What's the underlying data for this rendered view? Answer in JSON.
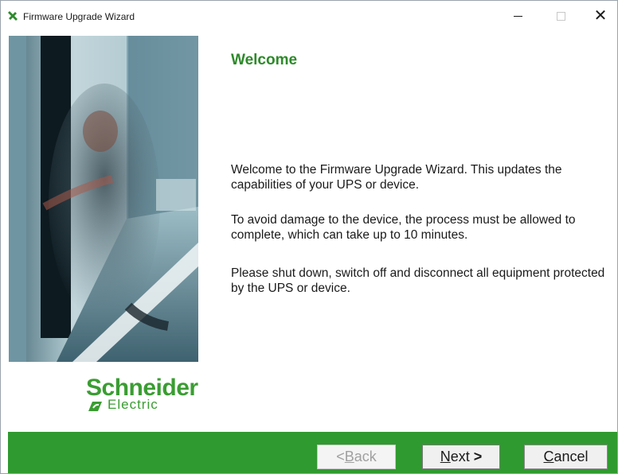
{
  "window": {
    "title": "Firmware Upgrade Wizard",
    "controls": {
      "minimize": "minimize",
      "maximize": "maximize",
      "close": "close"
    }
  },
  "branding": {
    "logo_main": "Schneider",
    "logo_sub": "Electric",
    "brand_color": "#3a9d32",
    "footer_color": "#2f9a2f"
  },
  "content": {
    "heading": "Welcome",
    "paragraphs": [
      "Welcome to the Firmware Upgrade Wizard. This updates the capabilities of your UPS or device.",
      "To avoid damage to the device, the process must be allowed to complete, which can take up to 10 minutes.",
      "Please shut down, switch off and disconnect all equipment protected by the UPS or device."
    ]
  },
  "buttons": {
    "back": {
      "mnemonic": "B",
      "rest": "ack",
      "prefix": "< ",
      "enabled": false
    },
    "next": {
      "mnemonic": "N",
      "rest": "ext",
      "suffix": " >",
      "enabled": true
    },
    "cancel": {
      "mnemonic": "C",
      "rest": "ancel",
      "enabled": true
    }
  }
}
